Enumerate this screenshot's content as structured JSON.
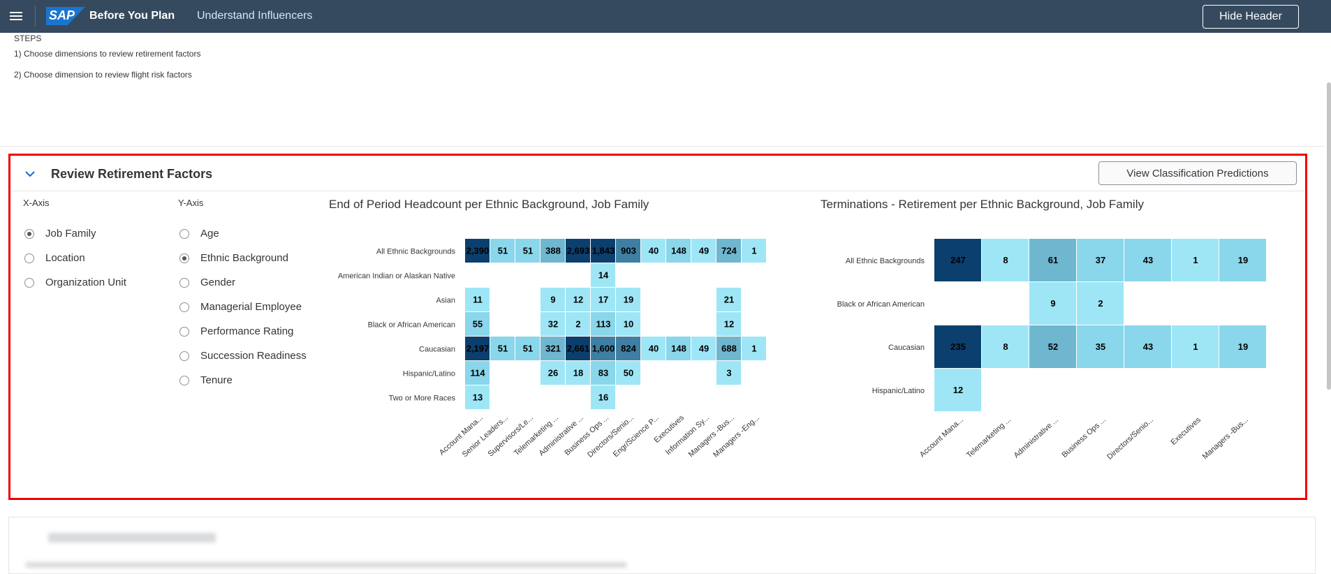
{
  "shell": {
    "logo_text": "SAP",
    "app_title": "Before You Plan",
    "subtitle": "Understand Influencers",
    "hide_header_label": "Hide Header"
  },
  "steps": {
    "title": "STEPS",
    "step1": "1) Choose dimensions to review retirement factors",
    "step2": "2) Choose dimension to review flight risk factors"
  },
  "panel": {
    "title": "Review Retirement Factors",
    "view_button": "View Classification Predictions",
    "x_axis_label": "X-Axis",
    "y_axis_label": "Y-Axis",
    "x_options": [
      {
        "label": "Job Family",
        "selected": true
      },
      {
        "label": "Location",
        "selected": false
      },
      {
        "label": "Organization Unit",
        "selected": false
      }
    ],
    "y_options": [
      {
        "label": "Age",
        "selected": false
      },
      {
        "label": "Ethnic Background",
        "selected": true
      },
      {
        "label": "Gender",
        "selected": false
      },
      {
        "label": "Managerial Employee",
        "selected": false
      },
      {
        "label": "Performance Rating",
        "selected": false
      },
      {
        "label": "Succession Readiness",
        "selected": false
      },
      {
        "label": "Tenure",
        "selected": false
      }
    ]
  },
  "colors": {
    "shell_bg": "#354a5f",
    "heat_low": "#9ee6f6",
    "heat_mid": "#7ec4da",
    "heat_high": "#0b3f6e",
    "highlight_border": "#ee0000"
  },
  "chart_data": [
    {
      "type": "heatmap",
      "title": "End of Period Headcount per Ethnic Background, Job Family",
      "x": [
        "Account Mana...",
        "Senior Leaders...",
        "Supervisors/Le...",
        "Telemarketing ...",
        "Administrative ...",
        "Business Ops ...",
        "Directors/Senio...",
        "Engr/Science P...",
        "Executives",
        "Information Sy...",
        "Managers -Bus...",
        "Managers -Eng..."
      ],
      "y": [
        "All Ethnic Backgrounds",
        "American Indian or Alaskan Native",
        "Asian",
        "Black or African American",
        "Caucasian",
        "Hispanic/Latino",
        "Two or More Races"
      ],
      "values": [
        [
          2390,
          51,
          51,
          388,
          2693,
          1843,
          903,
          40,
          148,
          49,
          724,
          1
        ],
        [
          null,
          null,
          null,
          null,
          null,
          14,
          null,
          null,
          null,
          null,
          null,
          null
        ],
        [
          11,
          null,
          null,
          9,
          12,
          17,
          19,
          null,
          null,
          null,
          21,
          null
        ],
        [
          55,
          null,
          null,
          32,
          2,
          113,
          10,
          null,
          null,
          null,
          12,
          null
        ],
        [
          2197,
          51,
          51,
          321,
          2661,
          1600,
          824,
          40,
          148,
          49,
          688,
          1
        ],
        [
          114,
          null,
          null,
          26,
          18,
          83,
          50,
          null,
          null,
          null,
          3,
          null
        ],
        [
          13,
          null,
          null,
          null,
          null,
          16,
          null,
          null,
          null,
          null,
          null,
          null
        ]
      ]
    },
    {
      "type": "heatmap",
      "title": "Terminations - Retirement per Ethnic Background, Job Family",
      "x": [
        "Account Mana...",
        "Telemarketing ...",
        "Administrative ...",
        "Business Ops ...",
        "Directors/Senio...",
        "Executives",
        "Managers -Bus..."
      ],
      "y": [
        "All Ethnic Backgrounds",
        "Black or African American",
        "Caucasian",
        "Hispanic/Latino"
      ],
      "values": [
        [
          247,
          8,
          61,
          37,
          43,
          1,
          19
        ],
        [
          null,
          null,
          9,
          2,
          null,
          null,
          null
        ],
        [
          235,
          8,
          52,
          35,
          43,
          1,
          19
        ],
        [
          12,
          null,
          null,
          null,
          null,
          null,
          null
        ]
      ]
    }
  ]
}
